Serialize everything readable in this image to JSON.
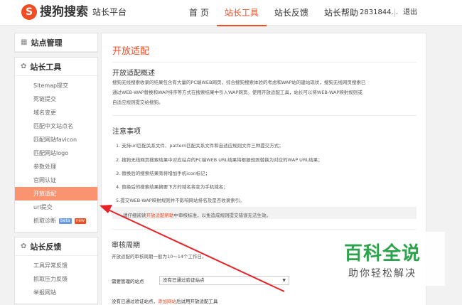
{
  "header": {
    "logo_mark": "S",
    "logo_text": "搜狗搜索",
    "logo_sub": "站长平台",
    "nav": [
      {
        "label": "首 页",
        "active": false
      },
      {
        "label": "站长工具",
        "active": true
      },
      {
        "label": "站长反馈",
        "active": false
      },
      {
        "label": "站长帮助",
        "active": false
      }
    ],
    "user_id": "2831844...",
    "logout": "退出",
    "accent_color": "#f04d24"
  },
  "sidebar": {
    "site_manage": {
      "icon": "grid-icon",
      "title": "站点管理"
    },
    "tools": {
      "icon": "gear-icon",
      "title": "站长工具",
      "items": [
        {
          "label": "Sitemap提交"
        },
        {
          "label": "死链提交"
        },
        {
          "label": "域名变更"
        },
        {
          "label": "匹配中文站点名"
        },
        {
          "label": "匹配网站favicon"
        },
        {
          "label": "匹配网站logo"
        },
        {
          "label": "参数处理"
        },
        {
          "label": "官网认证"
        },
        {
          "label": "开放适配",
          "active": true
        },
        {
          "label": "url提交"
        },
        {
          "label": "抓取诊断",
          "badges": [
            "beta",
            "new"
          ]
        }
      ]
    },
    "feedback": {
      "icon": "gear-icon",
      "title": "站长反馈",
      "items": [
        {
          "label": "工具异常反馈"
        },
        {
          "label": "抓取压力反馈"
        },
        {
          "label": "举报网站"
        }
      ]
    }
  },
  "main": {
    "title": "开放适配",
    "overview": {
      "heading": "开放适配概述",
      "lines": [
        "搜狗无线搜索收录的结果包含有大量的PC端WEB网页，综合搜狗搜索体验的考虑和WAP站的建站现状，搜狗无线网页搜索已",
        "通过WEB-WAP替换和WAP排序等方式在搜索结果中引入WAP网页。使用开放适配工具，站长可以将WEB-WAP映射规则或",
        "自适应规则提交给搜狗。"
      ]
    },
    "notes": {
      "heading": "注意事项",
      "items": [
        "1. 支持url匹配关系文件、pattern匹配关系文件和自适应规则文件三种提交方式；",
        "2. 搜狗无线网页搜索结果中对应站点的PC端WEB URL结果将根据规则替换为对应的WAP URL结果；",
        "3. 替换后的搜索结果旁将增加手机icon标记；",
        "4. 替换后的搜索结果摘要下方的域名将变为手机域名；",
        "5.提交WEB-WAP映射规则并不影响网站排名及是否收录索引。"
      ],
      "highlight_pre": "请仔细阅读",
      "highlight_link": "开放适配帮助",
      "highlight_post": "中审核标准，以免造成规则提交错误无法生效。"
    },
    "review": {
      "heading": "审核周期",
      "text": "开放适配的审核周期一般为10～14个工作日。"
    },
    "form": {
      "label": "需要管理的站点",
      "select_value": "没有已通过验证站点"
    },
    "footer_pre": "没有已通过验证站点，",
    "footer_link": "添加网站",
    "footer_post": "后试用开放适配工具"
  },
  "watermark": {
    "big": "百科全说",
    "small": "助你轻松解决",
    "color": "#2aa34a"
  }
}
